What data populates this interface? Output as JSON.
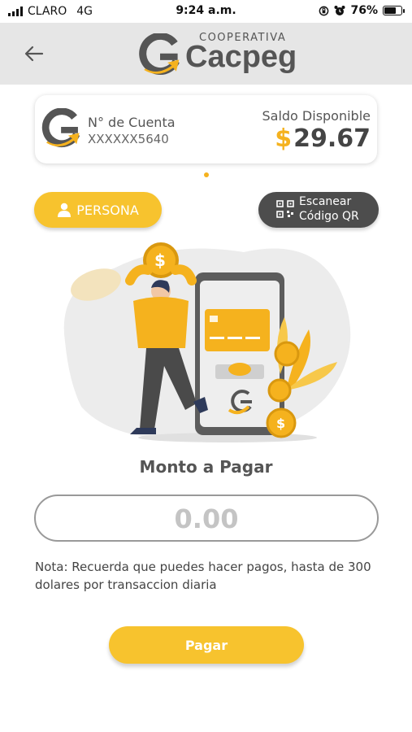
{
  "status_bar": {
    "carrier": "CLARO",
    "network": "4G",
    "time": "9:24 a.m.",
    "battery_percent": "76%",
    "battery_level": 0.76
  },
  "header": {
    "back_icon": "arrow-left-icon",
    "logo_subtitle": "COOPERATIVA",
    "logo_title": "Cacpeg"
  },
  "account": {
    "number_label": "N° de Cuenta",
    "number_value": "XXXXXX5640",
    "balance_label": "Saldo Disponible",
    "balance_currency": "$",
    "balance_value": "29.67"
  },
  "pager": {
    "active_index": 0
  },
  "actions": {
    "persona_label": "PERSONA",
    "scan_label_line1": "Escanear",
    "scan_label_line2": "Código QR"
  },
  "payment": {
    "title": "Monto a Pagar",
    "amount_placeholder": "0.00",
    "note": "Nota: Recuerda que puedes hacer pagos, hasta de 300 dolares por transaccion diaria",
    "submit_label": "Pagar"
  },
  "colors": {
    "accent": "#f7c32e",
    "dark": "#4d4d4d",
    "header_bg": "#e6e6e6"
  }
}
